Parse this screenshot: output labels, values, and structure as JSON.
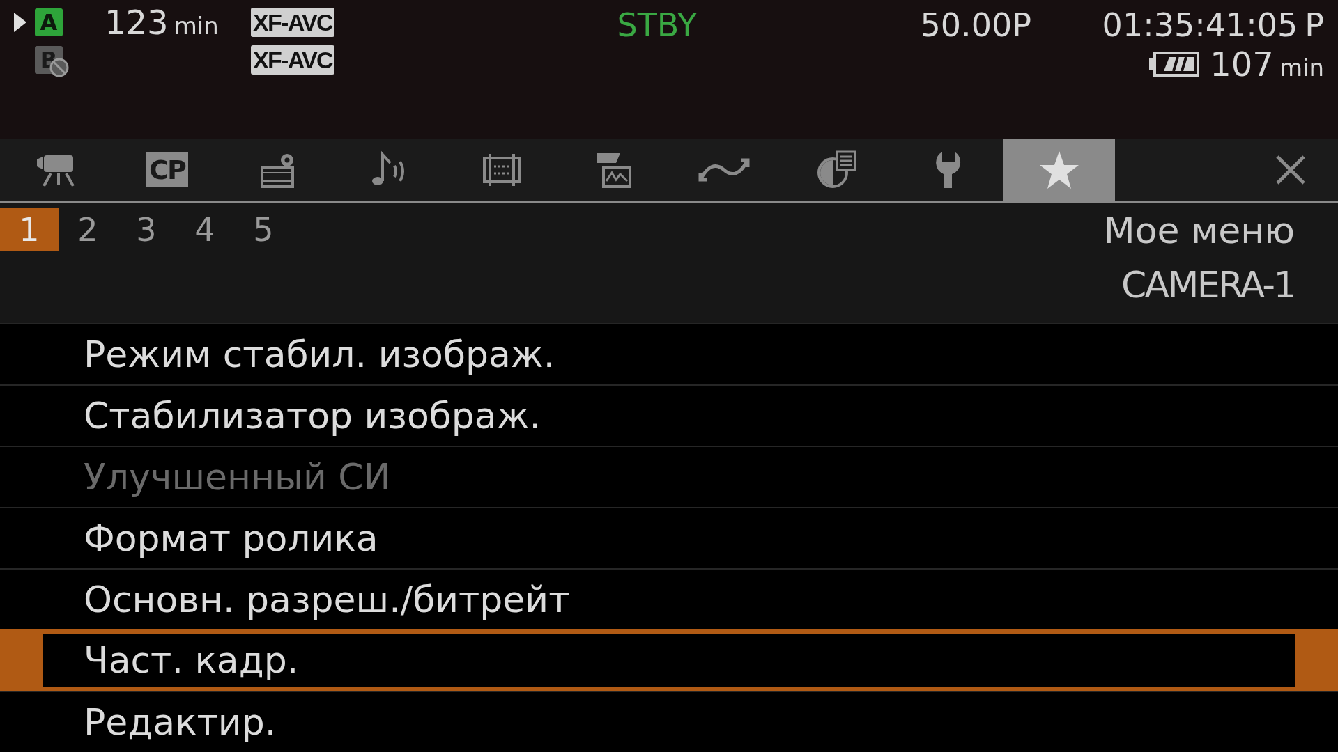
{
  "status_bar": {
    "media": [
      {
        "slot": "A",
        "available": true,
        "remaining": "123",
        "unit": "min",
        "format": "XF-AVC"
      },
      {
        "slot": "B",
        "available": false,
        "format": "XF-AVC"
      }
    ],
    "mode": "STBY",
    "frame_rate": "50.00P",
    "timecode": "01:35:41:05",
    "timecode_mode": "P",
    "battery_remaining": "107",
    "battery_unit": "min"
  },
  "tabs": [
    {
      "kind": "camera",
      "selected": false
    },
    {
      "kind": "custom-picture",
      "label": "CP",
      "selected": false
    },
    {
      "kind": "recording-setup",
      "selected": false
    },
    {
      "kind": "audio",
      "selected": false
    },
    {
      "kind": "monitor",
      "selected": false
    },
    {
      "kind": "assist",
      "selected": false
    },
    {
      "kind": "terminal",
      "selected": false
    },
    {
      "kind": "info",
      "selected": false
    },
    {
      "kind": "system",
      "selected": false
    },
    {
      "kind": "my-menu",
      "selected": true
    }
  ],
  "pages": [
    {
      "label": "1",
      "selected": true
    },
    {
      "label": "2",
      "selected": false
    },
    {
      "label": "3",
      "selected": false
    },
    {
      "label": "4",
      "selected": false
    },
    {
      "label": "5",
      "selected": false
    }
  ],
  "menu_title": "Мое меню",
  "submenu_title": "CAMERA-1",
  "items": [
    {
      "label": "Режим стабил. изображ.",
      "disabled": false,
      "selected": false
    },
    {
      "label": "Стабилизатор изображ.",
      "disabled": false,
      "selected": false
    },
    {
      "label": "Улучшенный СИ",
      "disabled": true,
      "selected": false
    },
    {
      "label": "Формат ролика",
      "disabled": false,
      "selected": false
    },
    {
      "label": "Основн. разреш./битрейт",
      "disabled": false,
      "selected": false
    },
    {
      "label": "Част. кадр.",
      "disabled": false,
      "selected": true
    },
    {
      "label": "Редактир.",
      "disabled": false,
      "selected": false
    }
  ]
}
